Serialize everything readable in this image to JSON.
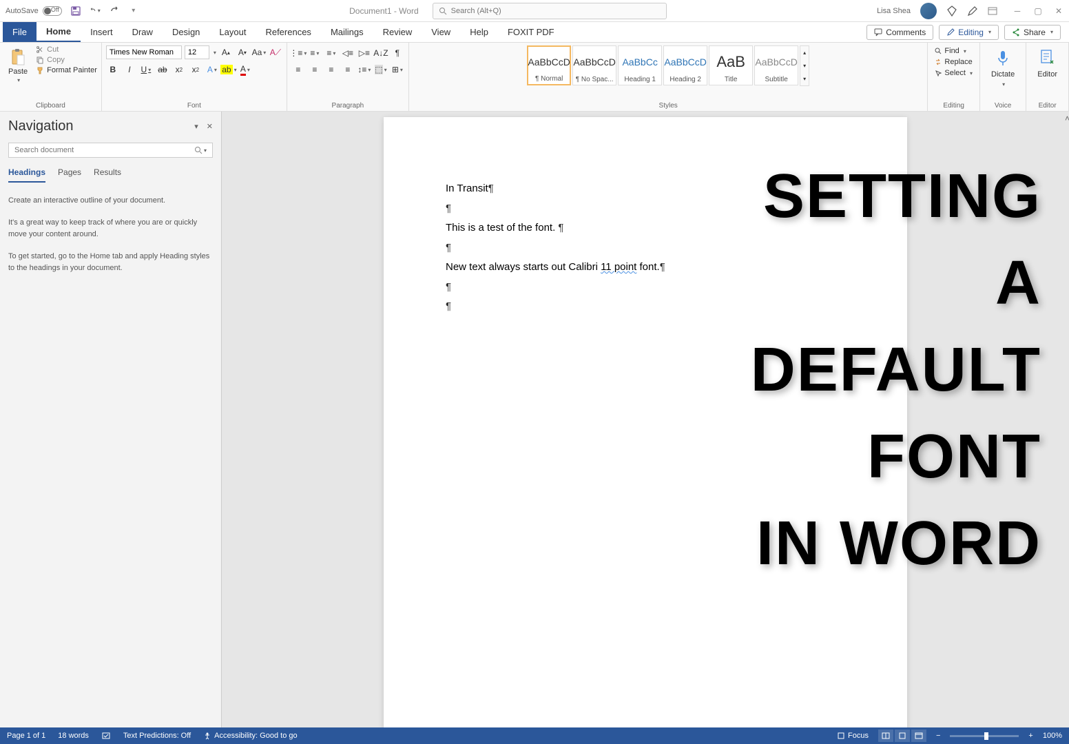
{
  "titlebar": {
    "autosave_label": "AutoSave",
    "autosave_state": "Off",
    "doc_title": "Document1 - Word",
    "search_placeholder": "Search (Alt+Q)",
    "user_name": "Lisa Shea"
  },
  "ribbon": {
    "tabs": [
      "File",
      "Home",
      "Insert",
      "Draw",
      "Design",
      "Layout",
      "References",
      "Mailings",
      "Review",
      "View",
      "Help",
      "FOXIT PDF"
    ],
    "comments": "Comments",
    "editing": "Editing",
    "share": "Share"
  },
  "clipboard": {
    "paste": "Paste",
    "cut": "Cut",
    "copy": "Copy",
    "format_painter": "Format Painter",
    "group_label": "Clipboard"
  },
  "font": {
    "name": "Times New Roman",
    "size": "12",
    "group_label": "Font"
  },
  "paragraph": {
    "group_label": "Paragraph"
  },
  "styles": {
    "items": [
      {
        "preview": "AaBbCcD",
        "name": "¶ Normal",
        "cls": ""
      },
      {
        "preview": "AaBbCcD",
        "name": "¶ No Spac...",
        "cls": ""
      },
      {
        "preview": "AaBbCc",
        "name": "Heading 1",
        "cls": "heading"
      },
      {
        "preview": "AaBbCcD",
        "name": "Heading 2",
        "cls": "heading"
      },
      {
        "preview": "AaB",
        "name": "Title",
        "cls": "title"
      },
      {
        "preview": "AaBbCcD",
        "name": "Subtitle",
        "cls": ""
      }
    ],
    "group_label": "Styles"
  },
  "editing": {
    "find": "Find",
    "replace": "Replace",
    "select": "Select",
    "group_label": "Editing"
  },
  "voice": {
    "dictate": "Dictate",
    "group_label": "Voice"
  },
  "editor": {
    "editor": "Editor",
    "group_label": "Editor"
  },
  "navigation": {
    "title": "Navigation",
    "search_placeholder": "Search document",
    "tabs": [
      "Headings",
      "Pages",
      "Results"
    ],
    "para1": "Create an interactive outline of your document.",
    "para2": "It's a great way to keep track of where you are or quickly move your content around.",
    "para3": "To get started, go to the Home tab and apply Heading styles to the headings in your document."
  },
  "document": {
    "line1": "In Transit",
    "line2": "This is a test of the font. ",
    "line3_a": "New text always starts out Calibri ",
    "line3_b": "11 point",
    "line3_c": " font."
  },
  "overlay": {
    "l1": "SETTING",
    "l2": "A",
    "l3": "DEFAULT",
    "l4": "FONT",
    "l5": "IN WORD"
  },
  "statusbar": {
    "page": "Page 1 of 1",
    "words": "18 words",
    "predictions": "Text Predictions: Off",
    "accessibility": "Accessibility: Good to go",
    "focus": "Focus",
    "zoom": "100%"
  }
}
